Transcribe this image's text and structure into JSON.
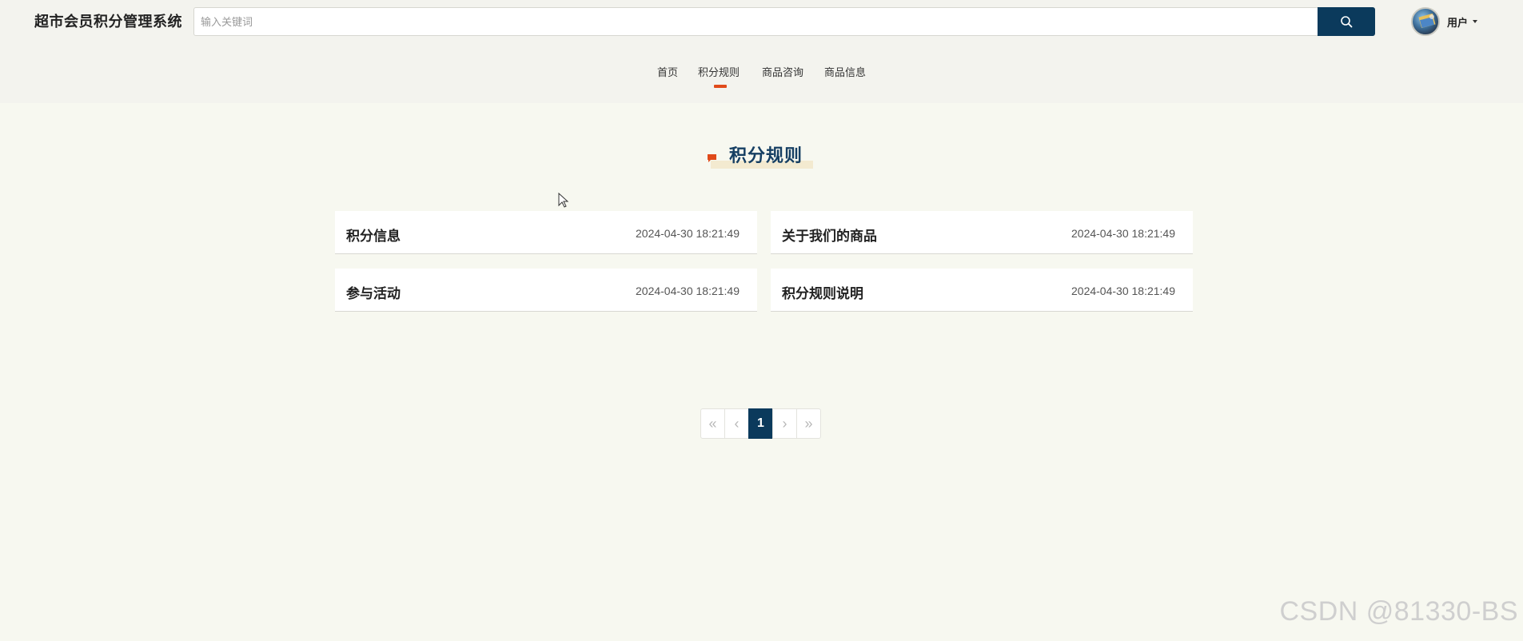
{
  "header": {
    "brand": "超市会员积分管理系统",
    "search_placeholder": "输入关键词",
    "search_value": "",
    "user_label": "用户",
    "accent_color": "#0b3a5c"
  },
  "nav": {
    "items": [
      {
        "label": "首页"
      },
      {
        "label": "积分规则"
      },
      {
        "label": "商品咨询"
      },
      {
        "label": "商品信息"
      }
    ],
    "active": "积分规则",
    "active_color": "#e04a1a"
  },
  "section": {
    "title": "积分规则"
  },
  "cards": [
    {
      "title": "积分信息",
      "date": "2024-04-30 18:21:49"
    },
    {
      "title": "关于我们的商品",
      "date": "2024-04-30 18:21:49"
    },
    {
      "title": "参与活动",
      "date": "2024-04-30 18:21:49"
    },
    {
      "title": "积分规则说明",
      "date": "2024-04-30 18:21:49"
    }
  ],
  "pagination": {
    "first": "«",
    "prev": "‹",
    "current": "1",
    "next": "›",
    "last": "»"
  },
  "watermark": "CSDN @81330-BS"
}
